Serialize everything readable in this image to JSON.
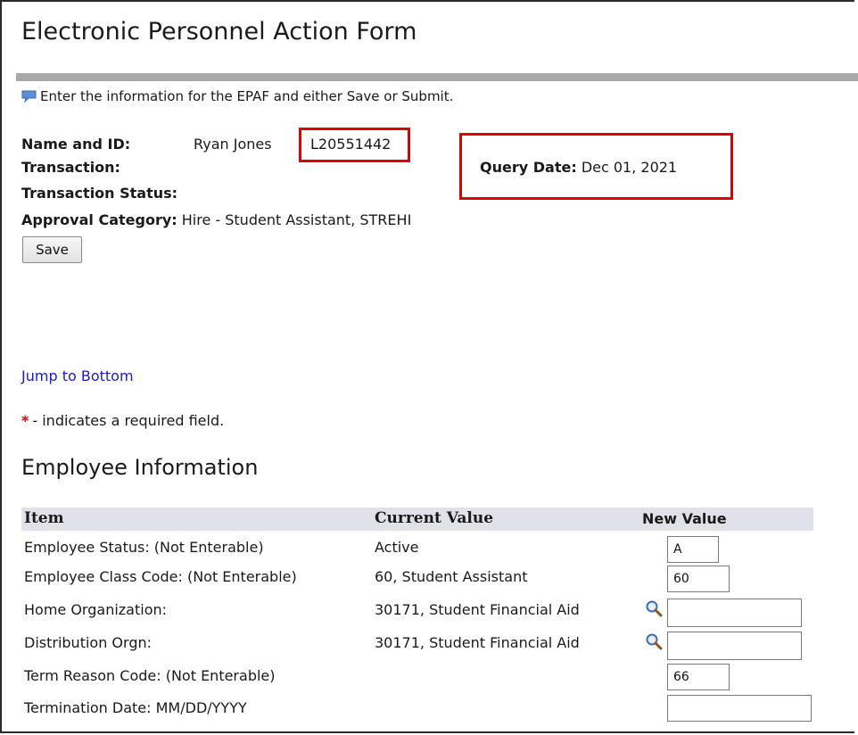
{
  "page": {
    "title": "Electronic Personnel Action Form",
    "instruction": "Enter the information for the EPAF and either Save or Submit."
  },
  "header_info": {
    "name_id_label": "Name and ID:",
    "name": "Ryan Jones",
    "id": "L20551442",
    "transaction_label": "Transaction:",
    "transaction_status_label": "Transaction Status:",
    "approval_category_label": "Approval Category:",
    "approval_category_value": "Hire - Student Assistant, STREHI",
    "query_date_label": "Query Date:",
    "query_date_value": "Dec 01, 2021"
  },
  "buttons": {
    "save": "Save"
  },
  "links": {
    "jump_to_bottom": "Jump to Bottom"
  },
  "required_note": {
    "star": "*",
    "text": "- indicates a required field."
  },
  "section": {
    "title": "Employee Information"
  },
  "table": {
    "headers": {
      "item": "Item",
      "current": "Current Value",
      "new": "New Value"
    },
    "rows": [
      {
        "item": "Employee Status: (Not Enterable)",
        "current": "Active",
        "new_value": "A"
      },
      {
        "item": "Employee Class Code: (Not Enterable)",
        "current": "60, Student Assistant",
        "new_value": "60"
      },
      {
        "item": "Home Organization:",
        "current": "30171, Student Financial Aid",
        "new_value": ""
      },
      {
        "item": "Distribution Orgn:",
        "current": "30171, Student Financial Aid",
        "new_value": ""
      },
      {
        "item": "Term Reason Code: (Not Enterable)",
        "current": "",
        "new_value": "66"
      },
      {
        "item": "Termination Date: MM/DD/YYYY",
        "current": "",
        "new_value": ""
      }
    ]
  },
  "icons": {
    "info": "info-speech-bubble-icon",
    "lookup": "magnifier-search-icon"
  },
  "colors": {
    "highlight": "#e00000",
    "link": "#1a1ad6",
    "table_header_bg": "#e1e1ea",
    "rule": "#a9a9a9"
  }
}
